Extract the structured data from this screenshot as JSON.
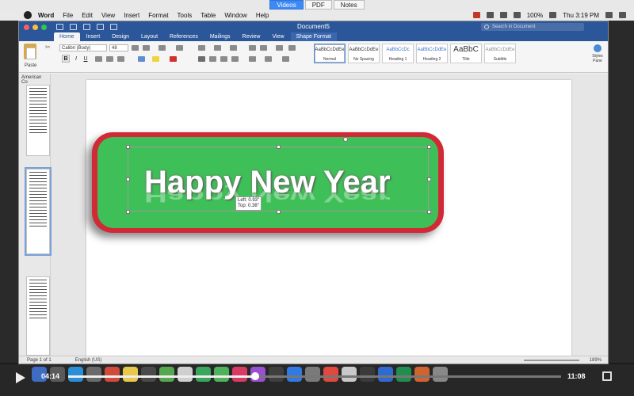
{
  "video_tabs": [
    {
      "label": "Videos",
      "active": true
    },
    {
      "label": "PDF",
      "active": false
    },
    {
      "label": "Notes",
      "active": false
    }
  ],
  "menubar": {
    "app": "Word",
    "items": [
      "File",
      "Edit",
      "View",
      "Insert",
      "Format",
      "Tools",
      "Table",
      "Window",
      "Help"
    ],
    "battery": "100%",
    "clock": "Thu 3:19 PM"
  },
  "window": {
    "doc_title": "Document5",
    "search_placeholder": "Search in Document"
  },
  "ribbon": {
    "tabs": [
      "Home",
      "Insert",
      "Design",
      "Layout",
      "References",
      "Mailings",
      "Review",
      "View",
      "Shape Format"
    ],
    "active_tab": "Home",
    "paste_label": "Paste",
    "font_name": "Calibri (Body)",
    "font_size": "48",
    "bold": "B",
    "italic": "I",
    "underline": "U",
    "styles": [
      {
        "sample": "AaBbCcDdEe",
        "name": "Normal"
      },
      {
        "sample": "AaBbCcDdEe",
        "name": "No Spacing"
      },
      {
        "sample": "AaBbCcDc",
        "name": "Heading 1"
      },
      {
        "sample": "AaBbCcDdEe",
        "name": "Heading 2"
      },
      {
        "sample": "AaBbC",
        "name": "Title"
      },
      {
        "sample": "AaBbCcDdEe",
        "name": "Subtitle"
      }
    ],
    "styles_pane_label": "Styles Pane"
  },
  "nav_pane": {
    "header": "American Co"
  },
  "document": {
    "wordart_text": "Happy New Year",
    "tooltip_left": "Left: 0.93\"",
    "tooltip_top": "Top: 0.38\""
  },
  "statusbar": {
    "page": "Page 1 of 1",
    "language": "English (US)",
    "zoom": "189%"
  },
  "player": {
    "elapsed": "04:14",
    "total": "11:08",
    "progress": 0.38
  }
}
